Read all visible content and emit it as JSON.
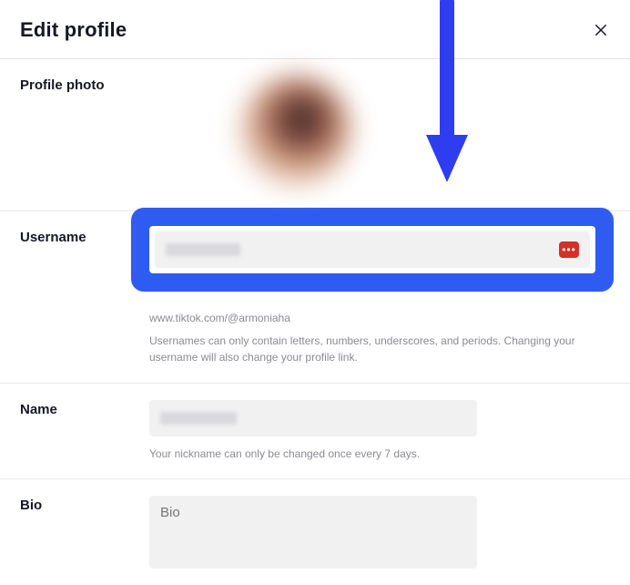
{
  "header": {
    "title": "Edit profile"
  },
  "photo": {
    "label": "Profile photo"
  },
  "username": {
    "label": "Username",
    "url_text": "www.tiktok.com/@armoniaha",
    "help": "Usernames can only contain letters, numbers, underscores, and periods. Changing your username will also change your profile link."
  },
  "name": {
    "label": "Name",
    "help": "Your nickname can only be changed once every 7 days."
  },
  "bio": {
    "label": "Bio",
    "placeholder": "Bio"
  }
}
